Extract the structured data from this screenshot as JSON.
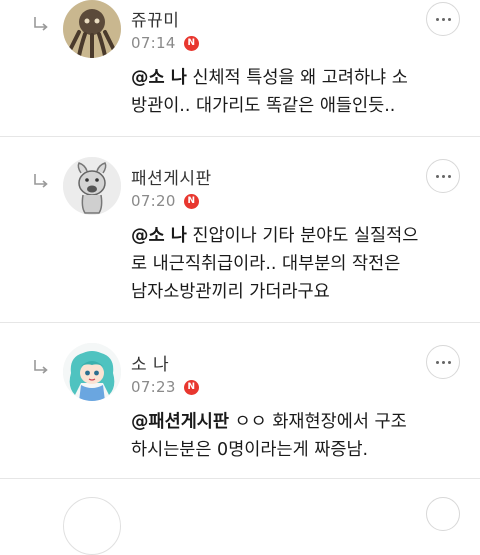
{
  "comments": [
    {
      "username": "쥬뀨미",
      "time": "07:14",
      "badge": "N",
      "mention": "@소 나",
      "text_line1": "  신체적 특성을 왜 고려하냐 소",
      "text_line2": "방관이.. 대가리도 똑같은 애들인듯..",
      "avatar_icon": "octopus-avatar-icon"
    },
    {
      "username": "패션게시판",
      "time": "07:20",
      "badge": "N",
      "mention": "@소 나",
      "text_line1": "  진압이나 기타 분야도 실질적으",
      "text_line2": "로 내근직취급이라.. 대부분의 작전은",
      "text_line3": "남자소방관끼리 가더라구요",
      "avatar_icon": "dog-sketch-avatar-icon"
    },
    {
      "username": "소 나",
      "time": "07:23",
      "badge": "N",
      "mention": "@패션게시판",
      "text_line1": " ㅇㅇ 화재현장에서 구조",
      "text_line2": "하시는분은 0명이라는게 짜증남.",
      "avatar_icon": "anime-girl-avatar-icon"
    }
  ],
  "colors": {
    "badge": "#e8372f",
    "divider": "#e6e6e6",
    "time": "#8a8a8a"
  }
}
